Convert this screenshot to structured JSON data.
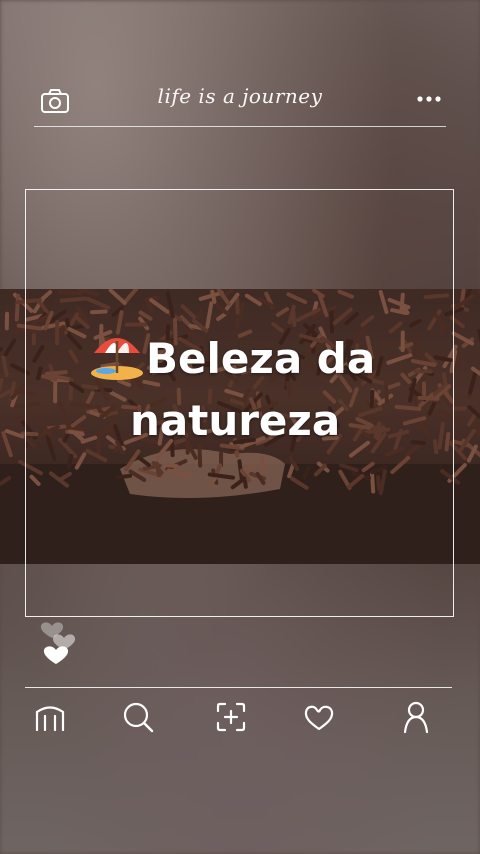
{
  "header": {
    "brand_text": "life is a journey",
    "camera_icon": "camera-icon",
    "more_icon": "more-icon"
  },
  "post": {
    "caption_line1": "Beleza da",
    "caption_line2": "natureza",
    "emoji_icon": "beach-umbrella-icon"
  },
  "reactions": {
    "icon": "hearts-icon"
  },
  "nav": {
    "items": [
      {
        "icon": "home-icon"
      },
      {
        "icon": "search-icon"
      },
      {
        "icon": "add-icon"
      },
      {
        "icon": "heart-icon"
      },
      {
        "icon": "profile-icon"
      }
    ]
  },
  "colors": {
    "ui_lines": "#ffffff",
    "photo_base": "#3f2a24",
    "sprinkles": "#5a372b"
  }
}
